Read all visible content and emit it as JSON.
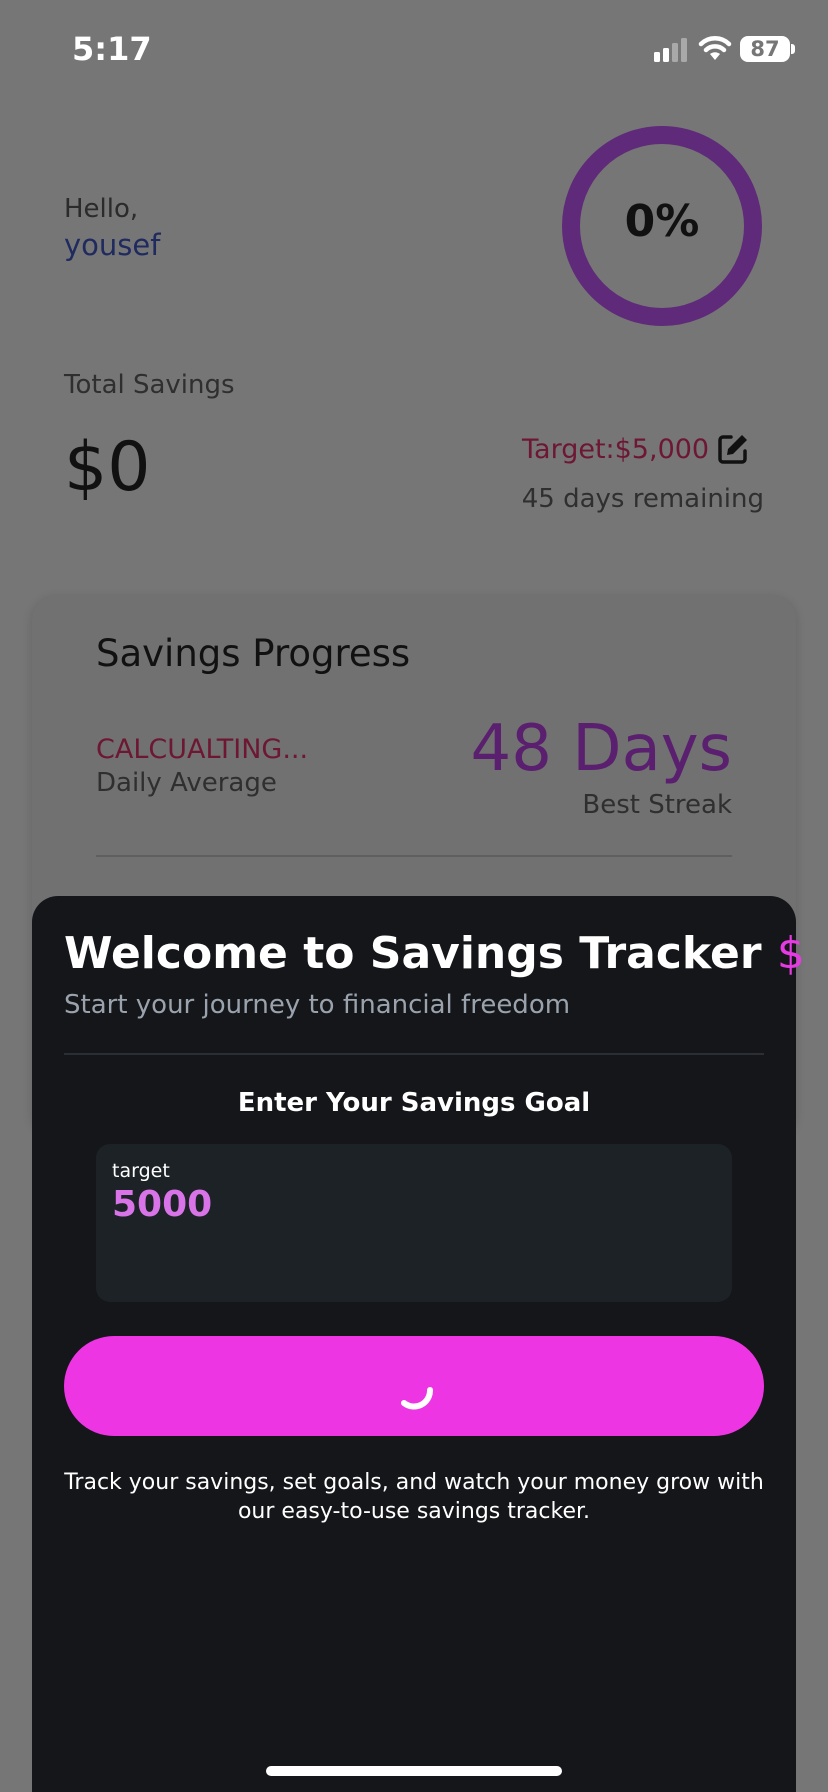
{
  "status_bar": {
    "time": "5:17",
    "battery": "87"
  },
  "header": {
    "greeting": "Hello,",
    "username": "yousef"
  },
  "progress_ring": {
    "percent_label": "0%",
    "percent": 0,
    "color": "#5f2a79"
  },
  "savings": {
    "total_label": "Total Savings",
    "total_value": "$0",
    "target_label": "Target:$5,000",
    "days_remaining": "45 days remaining"
  },
  "progress_card": {
    "title": "Savings Progress",
    "daily_average_value": "CALCUALTING...",
    "daily_average_label": "Daily Average",
    "streak_value": "48 Days",
    "streak_label": "Best Streak"
  },
  "modal": {
    "title": "Welcome to Savings Tracker",
    "title_icon": "$",
    "subtitle": "Start your journey to financial freedom",
    "goal_label": "Enter Your Savings Goal",
    "input_label": "target",
    "input_value": "5000",
    "footer_text": "Track your savings, set goals, and watch your money grow with our easy-to-use savings tracker."
  },
  "colors": {
    "accent": "#ee35e3",
    "sheet_background": "#141619",
    "overlay_background": "#767676",
    "input_value": "#d873e8"
  }
}
